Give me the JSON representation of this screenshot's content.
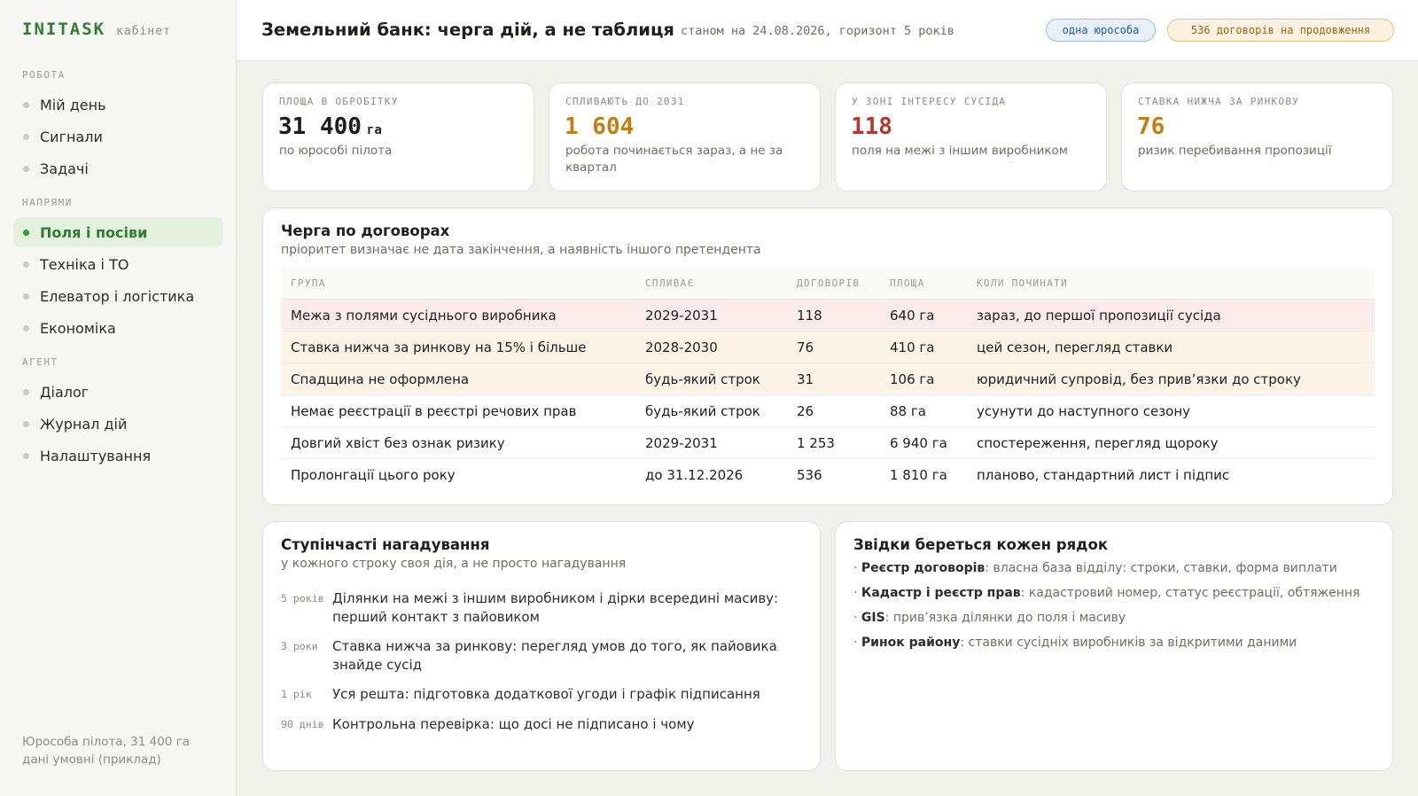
{
  "app": {
    "brand": "INITASK",
    "brand_sub": "кабінет"
  },
  "sidebar": {
    "sections": [
      {
        "label": "РОБОТА",
        "items": [
          {
            "label": "Мій день",
            "active": false
          },
          {
            "label": "Сигнали",
            "active": false
          },
          {
            "label": "Задачі",
            "active": false
          }
        ]
      },
      {
        "label": "НАПРЯМИ",
        "items": [
          {
            "label": "Поля і посіви",
            "active": true
          },
          {
            "label": "Техніка і ТО",
            "active": false
          },
          {
            "label": "Елеватор і логістика",
            "active": false
          },
          {
            "label": "Економіка",
            "active": false
          }
        ]
      },
      {
        "label": "АГЕНТ",
        "items": [
          {
            "label": "Діалог",
            "active": false
          },
          {
            "label": "Журнал дій",
            "active": false
          },
          {
            "label": "Налаштування",
            "active": false
          }
        ]
      }
    ],
    "footer": {
      "line1": "Юрособа пілота, 31 400 га",
      "line2": "дані умовні (приклад)"
    }
  },
  "header": {
    "title": "Земельний банк: черга дій, а не таблиця",
    "subtitle": "станом на 24.08.2026, горизонт 5 років",
    "badge_entity": "одна юрособа",
    "badge_renewals": "536 договорів на продовження"
  },
  "kpis": [
    {
      "label": "ПЛОЩА В ОБРОБІТКУ",
      "value": "31 400",
      "unit": "га",
      "note": "по юрособі пілота",
      "color": "#1d1f1c"
    },
    {
      "label": "СПЛИВАЮТЬ ДО 2031",
      "value": "1 604",
      "unit": "",
      "note": "робота починається зараз, а не за квартал",
      "color": "#c47d10"
    },
    {
      "label": "У ЗОНІ ІНТЕРЕСУ СУСІДА",
      "value": "118",
      "unit": "",
      "note": "поля на межі з іншим виробником",
      "color": "#b23a2e"
    },
    {
      "label": "СТАВКА НИЖЧА ЗА РИНКОВУ",
      "value": "76",
      "unit": "",
      "note": "ризик перебивання пропозиції",
      "color": "#c47d10"
    }
  ],
  "queue": {
    "title": "Черга по договорах",
    "subtitle": "пріоритет визначає не дата закінчення, а наявність іншого претендента",
    "columns": [
      "ГРУПА",
      "СПЛИВАЄ",
      "ДОГОВОРІВ",
      "ПЛОЩА",
      "КОЛИ ПОЧИНАТИ"
    ],
    "rows": [
      {
        "group": "Межа з полями сусіднього виробника",
        "expires": "2029-2031",
        "count": "118",
        "area": "640 га",
        "when": "зараз, до першої пропозиції сусіда",
        "tone": "red"
      },
      {
        "group": "Ставка нижча за ринкову на 15% і більше",
        "expires": "2028-2030",
        "count": "76",
        "area": "410 га",
        "when": "цей сезон, перегляд ставки",
        "tone": "amber"
      },
      {
        "group": "Спадщина не оформлена",
        "expires": "будь-який строк",
        "count": "31",
        "area": "106 га",
        "when": "юридичний супровід, без прив’язки до строку",
        "tone": "amber"
      },
      {
        "group": "Немає реєстрації в реєстрі речових прав",
        "expires": "будь-який строк",
        "count": "26",
        "area": "88 га",
        "when": "усунути до наступного сезону",
        "tone": "none"
      },
      {
        "group": "Довгий хвіст без ознак ризику",
        "expires": "2029-2031",
        "count": "1 253",
        "area": "6 940 га",
        "when": "спостереження, перегляд щороку",
        "tone": "none"
      },
      {
        "group": "Пролонгації цього року",
        "expires": "до 31.12.2026",
        "count": "536",
        "area": "1 810 га",
        "when": "планово, стандартний лист і підпис",
        "tone": "none"
      }
    ]
  },
  "reminders": {
    "title": "Ступінчасті нагадування",
    "subtitle": "у кожного строку своя дія, а не просто нагадування",
    "steps": [
      {
        "when": "5 років",
        "text": "Ділянки на межі з іншим виробником і дірки всередині масиву: перший контакт з пайовиком"
      },
      {
        "when": "3 роки",
        "text": "Ставка нижча за ринкову: перегляд умов до того, як пайовика знайде сусід"
      },
      {
        "when": "1 рік",
        "text": "Уся решта: підготовка додаткової угоди і графік підписання"
      },
      {
        "when": "90 днів",
        "text": "Контрольна перевірка: що досі не підписано і чому"
      }
    ]
  },
  "sources": {
    "title": "Звідки береться кожен рядок",
    "items": [
      {
        "name": "Реєстр договорів",
        "desc": ": власна база відділу: строки, ставки, форма виплати"
      },
      {
        "name": "Кадастр і реєстр прав",
        "desc": ": кадастровий номер, статус реєстрації, обтяження"
      },
      {
        "name": "GIS",
        "desc": ": прив’язка ділянки до поля і масиву"
      },
      {
        "name": "Ринок району",
        "desc": ": ставки сусідніх виробників за відкритими даними"
      }
    ]
  }
}
